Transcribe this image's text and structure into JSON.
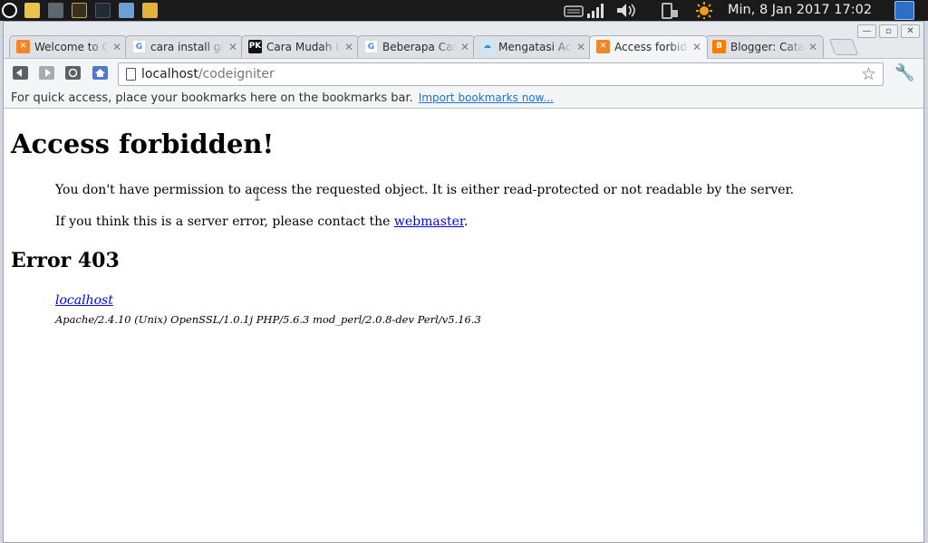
{
  "system_panel": {
    "clock": "Min,  8 Jan 2017 17:02",
    "launcher_icons": [
      "opera-icon",
      "notes-icon",
      "eye-icon",
      "terminal-icon",
      "terminal-dark-icon",
      "screenshot-icon",
      "folder-icon"
    ],
    "tray_icons": [
      "keyboard-icon",
      "signal-icon",
      "volume-icon",
      "battery-icon",
      "weather-sun-icon",
      "desktop-switch-icon"
    ]
  },
  "window_controls": {
    "minimize": "—",
    "maximize": "▫",
    "close": "✕"
  },
  "tabs": [
    {
      "title": "Welcome to CodeIgniter",
      "favicon": "xampp-icon",
      "close": "✕"
    },
    {
      "title": "cara install gin",
      "favicon": "google-icon",
      "close": "✕"
    },
    {
      "title": "Cara Mudah Install",
      "favicon": "pk-icon",
      "close": "✕"
    },
    {
      "title": "Beberapa Cara",
      "favicon": "google-icon",
      "close": "✕"
    },
    {
      "title": "Mengatasi Access",
      "favicon": "cloud-icon",
      "close": "✕"
    },
    {
      "title": "Access forbidden!",
      "favicon": "xampp-icon",
      "close": "✕"
    },
    {
      "title": "Blogger: Catatan",
      "favicon": "blogger-icon",
      "close": "✕"
    }
  ],
  "toolbar": {
    "url_host": "localhost",
    "url_path": "/codeigniter",
    "star_glyph": "☆",
    "wrench_glyph": "🔧"
  },
  "bookmarks_bar": {
    "message": "For quick access, place your bookmarks here on the bookmarks bar.",
    "import_link": "Import bookmarks now..."
  },
  "page": {
    "heading": "Access forbidden!",
    "paragraph1": "You don't have permission to access the requested object. It is either read-protected or not readable by the server.",
    "paragraph2_prefix": "If you think this is a server error, please contact the ",
    "paragraph2_link": "webmaster",
    "paragraph2_suffix": ".",
    "error_heading": "Error 403",
    "address_link": "localhost",
    "server_signature": "Apache/2.4.10 (Unix) OpenSSL/1.0.1j PHP/5.6.3 mod_perl/2.0.8-dev Perl/v5.16.3"
  },
  "colors": {
    "xampp": "#f0862a",
    "google_blue": "#4285f4",
    "blogger": "#f57d00",
    "link": "#0000ee",
    "bookmark_link": "#1b73d1"
  }
}
